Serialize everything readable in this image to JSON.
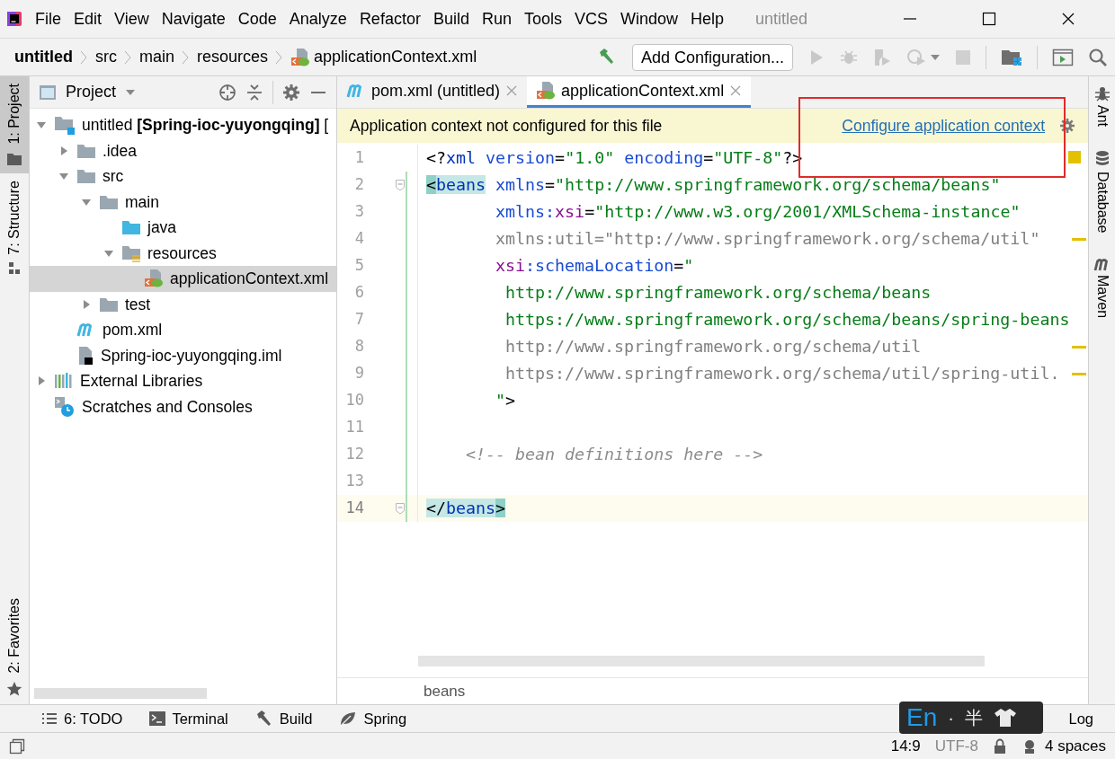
{
  "window": {
    "title": "untitled"
  },
  "menu": [
    {
      "label": "File"
    },
    {
      "label": "Edit"
    },
    {
      "label": "View"
    },
    {
      "label": "Navigate"
    },
    {
      "label": "Code"
    },
    {
      "label": "Analyze"
    },
    {
      "label": "Refactor"
    },
    {
      "label": "Build"
    },
    {
      "label": "Run"
    },
    {
      "label": "Tools"
    },
    {
      "label": "VCS"
    },
    {
      "label": "Window"
    },
    {
      "label": "Help"
    }
  ],
  "breadcrumbs": [
    {
      "label": "untitled",
      "kind": "project"
    },
    {
      "label": "src",
      "kind": "folder"
    },
    {
      "label": "main",
      "kind": "folder"
    },
    {
      "label": "resources",
      "kind": "folder"
    },
    {
      "label": "applicationContext.xml",
      "kind": "xml-file"
    }
  ],
  "toolbar": {
    "run_configuration": "Add Configuration..."
  },
  "side_tabs_left": {
    "top": [
      {
        "label": "1: Project",
        "selected": true,
        "kind": "project"
      },
      {
        "label": "7: Structure",
        "selected": false,
        "kind": "structure"
      }
    ],
    "bottom": [
      {
        "label": "2: Favorites",
        "selected": false,
        "kind": "favorites"
      }
    ]
  },
  "project_panel": {
    "title": "Project",
    "tree": [
      {
        "name": "untitled **[Spring-ioc-yuyongqing]** [",
        "kind": "module",
        "expanded": true,
        "selected": false,
        "children": [
          {
            "name": ".idea",
            "kind": "folder",
            "expanded": false,
            "selected": false
          },
          {
            "name": "src",
            "kind": "folder",
            "expanded": true,
            "selected": false,
            "children": [
              {
                "name": "main",
                "kind": "folder",
                "expanded": true,
                "selected": false,
                "children": [
                  {
                    "name": "java",
                    "kind": "source-folder",
                    "selected": false
                  },
                  {
                    "name": "resources",
                    "kind": "resources-folder",
                    "expanded": true,
                    "selected": false,
                    "children": [
                      {
                        "name": "applicationContext.xml",
                        "kind": "xml-file",
                        "selected": true
                      }
                    ]
                  }
                ]
              },
              {
                "name": "test",
                "kind": "folder",
                "expanded": false,
                "selected": false
              }
            ]
          },
          {
            "name": "pom.xml",
            "kind": "maven-file",
            "selected": false
          },
          {
            "name": "Spring-ioc-yuyongqing.iml",
            "kind": "iml-file",
            "selected": false
          }
        ]
      },
      {
        "name": "External Libraries",
        "kind": "libraries",
        "expanded": false,
        "selected": false
      },
      {
        "name": "Scratches and Consoles",
        "kind": "scratches",
        "selected": false
      }
    ]
  },
  "editor": {
    "tabs": [
      {
        "label": "pom.xml (untitled)",
        "kind": "maven",
        "selected": false
      },
      {
        "label": "applicationContext.xml",
        "kind": "xml",
        "selected": true
      }
    ],
    "banner": {
      "message": "Application context not configured for this file",
      "action": "Configure application context"
    },
    "lines": [
      {
        "number": "1",
        "current": false,
        "tokens": [
          {
            "kind": "punct",
            "text": "<?"
          },
          {
            "kind": "tag",
            "text": "xml"
          },
          {
            "kind": "attr",
            "text": " version"
          },
          {
            "kind": "punct",
            "text": "="
          },
          {
            "kind": "value",
            "text": "\"1.0\""
          },
          {
            "kind": "attr",
            "text": " encoding"
          },
          {
            "kind": "punct",
            "text": "="
          },
          {
            "kind": "value",
            "text": "\"UTF-8\""
          },
          {
            "kind": "punct",
            "text": "?>"
          }
        ]
      },
      {
        "number": "2",
        "current": false,
        "tokens": [
          {
            "kind": "bracket-strong",
            "text": "<"
          },
          {
            "kind": "tag-match",
            "text": "beans"
          },
          {
            "kind": "attr",
            "text": " xmlns"
          },
          {
            "kind": "punct",
            "text": "="
          },
          {
            "kind": "value",
            "text": "\"http://www.springframework.org/schema/beans\""
          }
        ]
      },
      {
        "number": "3",
        "current": false,
        "tokens": [
          {
            "kind": "attr",
            "text": "       xmlns:"
          },
          {
            "kind": "ns",
            "text": "xsi"
          },
          {
            "kind": "punct",
            "text": "="
          },
          {
            "kind": "value",
            "text": "\"http://www.w3.org/2001/XMLSchema-instance\""
          }
        ]
      },
      {
        "number": "4",
        "current": false,
        "tokens": [
          {
            "kind": "unused",
            "text": "       xmlns:util=\"http://www.springframework.org/schema/util\""
          }
        ]
      },
      {
        "number": "5",
        "current": false,
        "tokens": [
          {
            "kind": "ns",
            "text": "       xsi"
          },
          {
            "kind": "attr",
            "text": ":schemaLocation"
          },
          {
            "kind": "punct",
            "text": "="
          },
          {
            "kind": "value",
            "text": "\""
          }
        ]
      },
      {
        "number": "6",
        "current": false,
        "tokens": [
          {
            "kind": "value",
            "text": "        http://www.springframework.org/schema/beans"
          }
        ]
      },
      {
        "number": "7",
        "current": false,
        "tokens": [
          {
            "kind": "value",
            "text": "        https://www.springframework.org/schema/beans/spring-beans"
          }
        ]
      },
      {
        "number": "8",
        "current": false,
        "tokens": [
          {
            "kind": "unused",
            "text": "        http://www.springframework.org/schema/util"
          }
        ]
      },
      {
        "number": "9",
        "current": false,
        "tokens": [
          {
            "kind": "unused",
            "text": "        https://www.springframework.org/schema/util/spring-util."
          }
        ]
      },
      {
        "number": "10",
        "current": false,
        "tokens": [
          {
            "kind": "value",
            "text": "       \""
          },
          {
            "kind": "punct",
            "text": ">"
          }
        ]
      },
      {
        "number": "11",
        "current": false
      },
      {
        "number": "12",
        "current": false,
        "tokens": [
          {
            "kind": "comment",
            "text": "    <!-- bean definitions here -->"
          }
        ]
      },
      {
        "number": "13",
        "current": false
      },
      {
        "number": "14",
        "current": true,
        "tokens": [
          {
            "kind": "bracket-soft",
            "text": "</"
          },
          {
            "kind": "tag-match",
            "text": "beans"
          },
          {
            "kind": "bracket-strong",
            "text": ">"
          }
        ]
      }
    ],
    "breadcrumb": "beans"
  },
  "side_tabs_right": [
    {
      "label": "Ant",
      "kind": "ant"
    },
    {
      "label": "Database",
      "kind": "database"
    },
    {
      "label": "Maven",
      "kind": "maven"
    }
  ],
  "tool_tabs": [
    {
      "label": "6: TODO",
      "kind": "todo"
    },
    {
      "label": "Terminal",
      "kind": "terminal"
    },
    {
      "label": "Build",
      "kind": "build"
    },
    {
      "label": "Spring",
      "kind": "spring"
    }
  ],
  "log_tab": {
    "label": "Log"
  },
  "ime_toolbar": {
    "language": "En",
    "separator": "·",
    "width_mode": "半"
  },
  "status_bar": {
    "position": "14:9",
    "encoding": "UTF-8",
    "indent": "4 spaces"
  }
}
